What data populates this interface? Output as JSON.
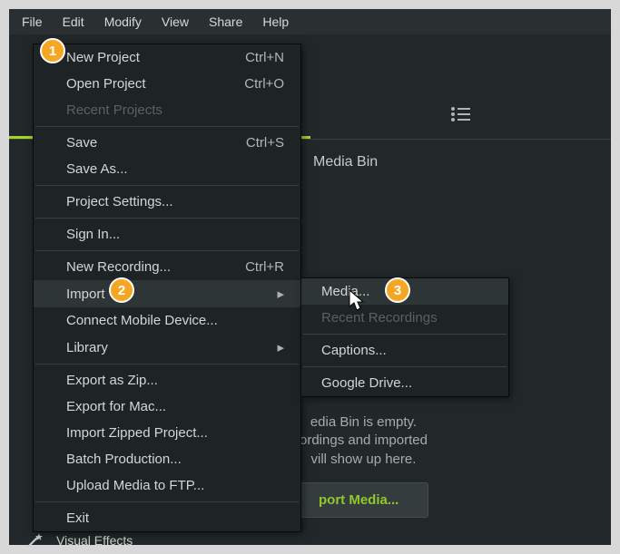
{
  "menubar": {
    "file": "File",
    "edit": "Edit",
    "modify": "Modify",
    "view": "View",
    "share": "Share",
    "help": "Help"
  },
  "dropdown": {
    "new_project": "New Project",
    "new_project_shortcut": "Ctrl+N",
    "open_project": "Open Project",
    "open_project_shortcut": "Ctrl+O",
    "recent_projects": "Recent Projects",
    "save": "Save",
    "save_shortcut": "Ctrl+S",
    "save_as": "Save As...",
    "project_settings": "Project Settings...",
    "sign_in": "Sign In...",
    "new_recording": "New Recording...",
    "new_recording_shortcut": "Ctrl+R",
    "import": "Import",
    "connect_mobile": "Connect Mobile Device...",
    "library": "Library",
    "export_zip": "Export as Zip...",
    "export_mac": "Export for Mac...",
    "import_zipped": "Import Zipped Project...",
    "batch_production": "Batch Production...",
    "upload_ftp": "Upload Media to FTP...",
    "exit": "Exit"
  },
  "submenu": {
    "media": "Media...",
    "recent_recordings": "Recent Recordings",
    "captions": "Captions...",
    "google_drive": "Google Drive..."
  },
  "panel": {
    "media_bin_label": "Media Bin",
    "empty_line1": "edia Bin is empty.",
    "empty_line2": "ordings and imported",
    "empty_line3": "vill show up here.",
    "import_button": "port Media..."
  },
  "sidebar": {
    "visual_effects": "Visual Effects"
  },
  "callouts": {
    "one": "1",
    "two": "2",
    "three": "3"
  }
}
